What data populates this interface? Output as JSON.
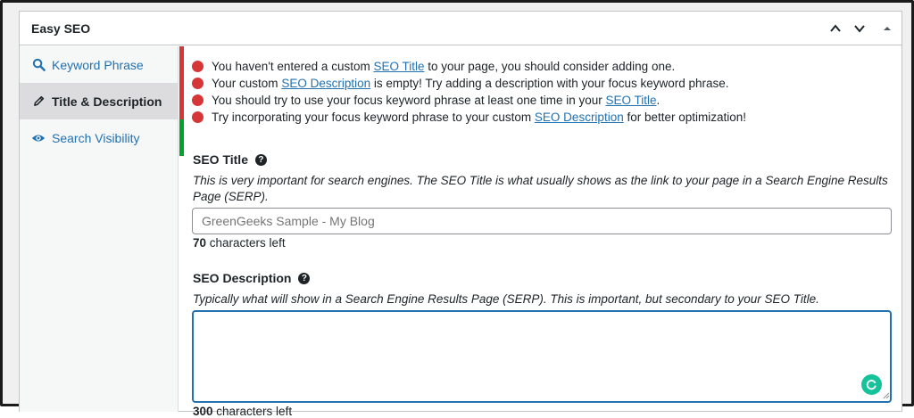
{
  "panel": {
    "title": "Easy SEO",
    "controls": [
      "chevron-up",
      "chevron-down",
      "caret-up"
    ]
  },
  "sidebar": {
    "tabs": [
      {
        "label": "Keyword Phrase",
        "icon": "search-icon",
        "status_color": "#d63638"
      },
      {
        "label": "Title & Description",
        "icon": "pencil-icon",
        "status_color": "#d63638",
        "active": true
      },
      {
        "label": "Search Visibility",
        "icon": "eye-icon",
        "status_color": "#00a32a"
      }
    ]
  },
  "notices": [
    {
      "pre": "You haven't entered a custom ",
      "link": "SEO Title",
      "post": " to your page, you should consider adding one."
    },
    {
      "pre": "Your custom ",
      "link": "SEO Description",
      "post": " is empty! Try adding a description with your focus keyword phrase."
    },
    {
      "pre": "You should try to use your focus keyword phrase at least one time in your ",
      "link": "SEO Title",
      "post": "."
    },
    {
      "pre": "Try incorporating your focus keyword phrase to your custom ",
      "link": "SEO Description",
      "post": " for better optimization!"
    }
  ],
  "seo_title": {
    "label": "SEO Title",
    "description_line1": "This is very important for search engines. The SEO Title is what usually shows as the link to your page in a Search Engine Results",
    "description_line2": "Page (SERP).",
    "placeholder": "GreenGeeks Sample - My Blog",
    "value": "",
    "chars_left": "70",
    "chars_left_suffix": " characters left"
  },
  "seo_description": {
    "label": "SEO Description",
    "description": "Typically what will show in a Search Engine Results Page (SERP). This is important, but secondary to your SEO Title.",
    "value": "",
    "chars_left": "300",
    "chars_left_suffix": " characters left"
  },
  "colors": {
    "error": "#d63638",
    "success": "#00a32a",
    "link": "#2271b1",
    "focus_border": "#2271b1",
    "grammarly": "#15c39a"
  }
}
